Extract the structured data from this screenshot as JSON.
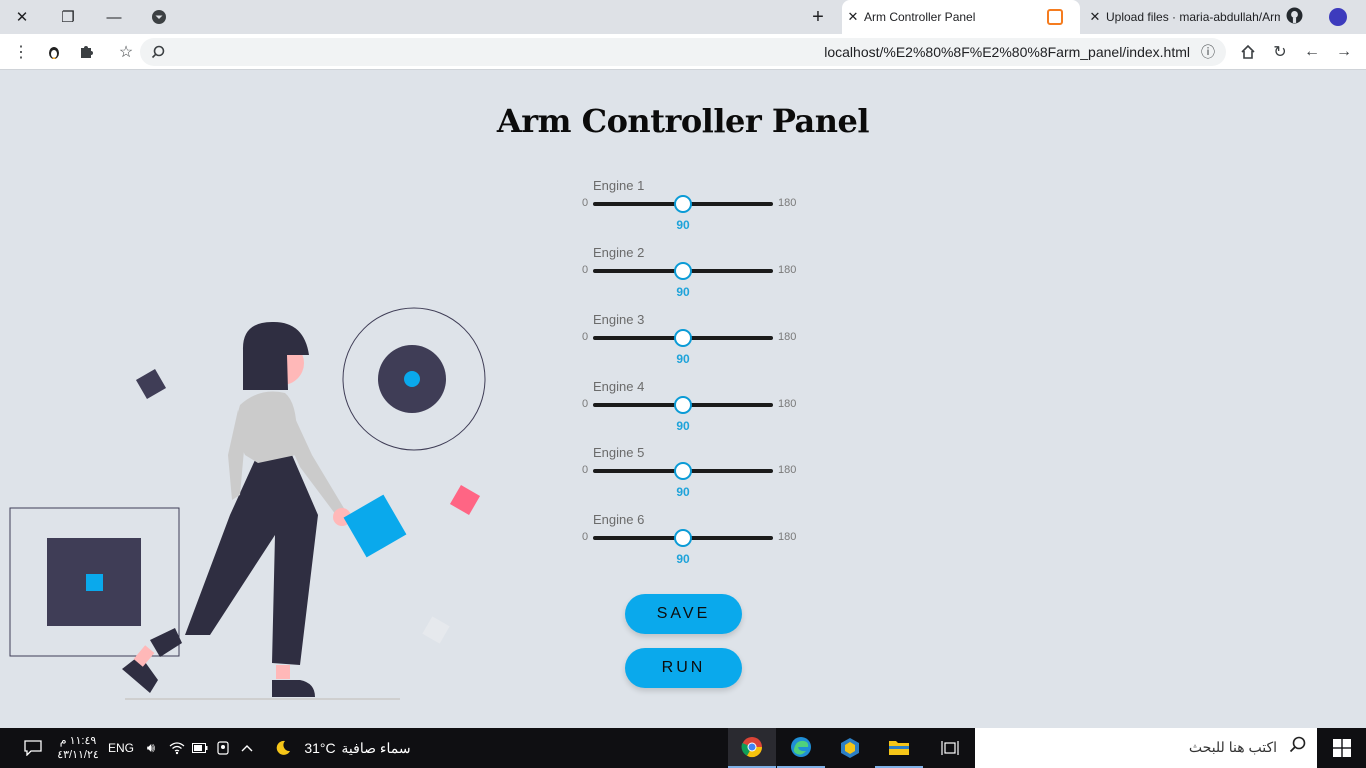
{
  "browser": {
    "tabs": [
      {
        "title": "Arm Controller Panel",
        "active": true
      },
      {
        "title": "Upload files · maria-abdullah/Arm",
        "active": false
      }
    ],
    "new_tab_label": "+",
    "url": "localhost/%E2%80%8F%E2%80%8Farm_panel/index.html"
  },
  "page": {
    "title": "Arm Controller Panel",
    "engines": [
      {
        "label": "Engine 1",
        "min": "0",
        "max": "180",
        "value": "90"
      },
      {
        "label": "Engine 2",
        "min": "0",
        "max": "180",
        "value": "90"
      },
      {
        "label": "Engine 3",
        "min": "0",
        "max": "180",
        "value": "90"
      },
      {
        "label": "Engine 4",
        "min": "0",
        "max": "180",
        "value": "90"
      },
      {
        "label": "Engine 5",
        "min": "0",
        "max": "180",
        "value": "90"
      },
      {
        "label": "Engine 6",
        "min": "0",
        "max": "180",
        "value": "90"
      }
    ],
    "save_label": "SAVE",
    "run_label": "RUN",
    "colors": {
      "accent": "#0aa9ec",
      "background": "#dee3e9"
    }
  },
  "taskbar": {
    "search_placeholder": "اكتب هنا للبحث",
    "weather_text": "سماء صافية",
    "temperature": "31°C",
    "language": "ENG",
    "time": "١١:٤٩ م",
    "date": "٤٣/١١/٢٤"
  }
}
